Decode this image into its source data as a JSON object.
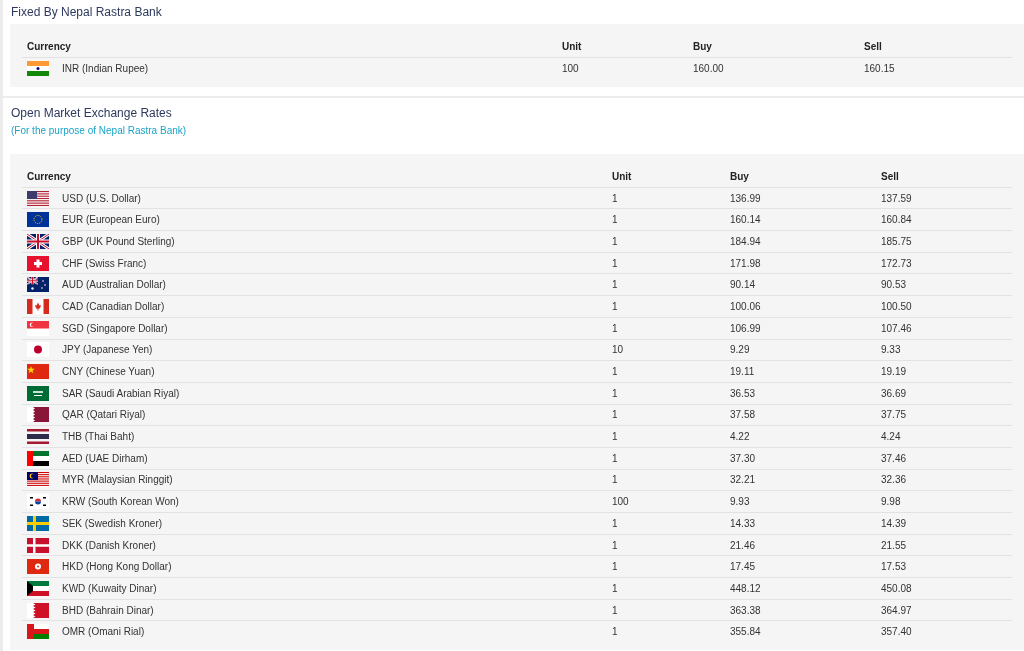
{
  "fixed_rates": {
    "title": "Fixed By Nepal Rastra Bank",
    "columns": [
      "Currency",
      "Unit",
      "Buy",
      "Sell"
    ],
    "rows": [
      {
        "currency": "INR (Indian Rupee)",
        "unit": "100",
        "buy": "160.00",
        "sell": "160.15"
      }
    ]
  },
  "open_market": {
    "title": "Open Market Exchange Rates",
    "subtitle": "(For the purpose of Nepal Rastra Bank)",
    "columns": [
      "Currency",
      "Unit",
      "Buy",
      "Sell"
    ],
    "rows": [
      {
        "currency": "USD (U.S. Dollar)",
        "unit": "1",
        "buy": "136.99",
        "sell": "137.59"
      },
      {
        "currency": "EUR (European Euro)",
        "unit": "1",
        "buy": "160.14",
        "sell": "160.84"
      },
      {
        "currency": "GBP (UK Pound Sterling)",
        "unit": "1",
        "buy": "184.94",
        "sell": "185.75"
      },
      {
        "currency": "CHF (Swiss Franc)",
        "unit": "1",
        "buy": "171.98",
        "sell": "172.73"
      },
      {
        "currency": "AUD (Australian Dollar)",
        "unit": "1",
        "buy": "90.14",
        "sell": "90.53"
      },
      {
        "currency": "CAD (Canadian Dollar)",
        "unit": "1",
        "buy": "100.06",
        "sell": "100.50"
      },
      {
        "currency": "SGD (Singapore Dollar)",
        "unit": "1",
        "buy": "106.99",
        "sell": "107.46"
      },
      {
        "currency": "JPY (Japanese Yen)",
        "unit": "10",
        "buy": "9.29",
        "sell": "9.33"
      },
      {
        "currency": "CNY (Chinese Yuan)",
        "unit": "1",
        "buy": "19.11",
        "sell": "19.19"
      },
      {
        "currency": "SAR (Saudi Arabian Riyal)",
        "unit": "1",
        "buy": "36.53",
        "sell": "36.69"
      },
      {
        "currency": "QAR (Qatari Riyal)",
        "unit": "1",
        "buy": "37.58",
        "sell": "37.75"
      },
      {
        "currency": "THB (Thai Baht)",
        "unit": "1",
        "buy": "4.22",
        "sell": "4.24"
      },
      {
        "currency": "AED (UAE Dirham)",
        "unit": "1",
        "buy": "37.30",
        "sell": "37.46"
      },
      {
        "currency": "MYR (Malaysian Ringgit)",
        "unit": "1",
        "buy": "32.21",
        "sell": "32.36"
      },
      {
        "currency": "KRW (South Korean Won)",
        "unit": "100",
        "buy": "9.93",
        "sell": "9.98"
      },
      {
        "currency": "SEK (Swedish Kroner)",
        "unit": "1",
        "buy": "14.33",
        "sell": "14.39"
      },
      {
        "currency": "DKK (Danish Kroner)",
        "unit": "1",
        "buy": "21.46",
        "sell": "21.55"
      },
      {
        "currency": "HKD (Hong Kong Dollar)",
        "unit": "1",
        "buy": "17.45",
        "sell": "17.53"
      },
      {
        "currency": "KWD (Kuwaity Dinar)",
        "unit": "1",
        "buy": "448.12",
        "sell": "450.08"
      },
      {
        "currency": "BHD (Bahrain Dinar)",
        "unit": "1",
        "buy": "363.38",
        "sell": "364.97"
      },
      {
        "currency": "OMR (Omani Rial)",
        "unit": "1",
        "buy": "355.84",
        "sell": "357.40"
      }
    ]
  }
}
